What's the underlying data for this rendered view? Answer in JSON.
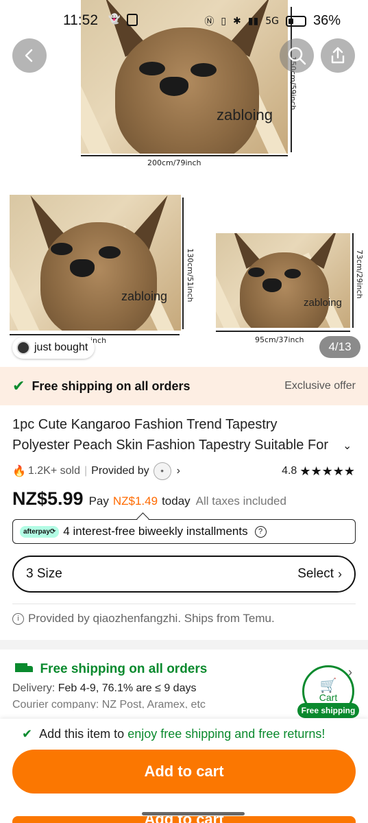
{
  "status_bar": {
    "time": "11:52",
    "battery_percent": "36%",
    "network": "5G"
  },
  "gallery": {
    "counter": "4/13",
    "just_bought": "just bought",
    "photos": [
      {
        "caption": "zabloing",
        "width_label": "200cm/79inch",
        "height_label": "150cm/59inch"
      },
      {
        "caption": "zabloing",
        "width_label": "inch",
        "height_label": "130cm/51inch"
      },
      {
        "caption": "zabloing",
        "width_label": "95cm/37inch",
        "height_label": "73cm/29inch"
      }
    ]
  },
  "shipping_banner": {
    "title": "Free shipping on all orders",
    "tag": "Exclusive offer"
  },
  "product": {
    "title": "1pc Cute Kangaroo Fashion Trend Tapestry Polyester Peach Skin Fashion Tapestry Suitable For Theme",
    "sold": "1.2K+ sold",
    "provided_by_label": "Provided by",
    "rating": "4.8",
    "stars": "★★★★★",
    "price": "NZ$5.99",
    "pay_label": "Pay",
    "pay_amount": "NZ$1.49",
    "pay_today": "today",
    "taxes": "All taxes included"
  },
  "afterpay": {
    "logo": "afterpay⟳",
    "text": "4 interest-free biweekly installments"
  },
  "size": {
    "label": "3 Size",
    "action": "Select"
  },
  "provided": "Provided by qiaozhenfangzhi. Ships from Temu.",
  "delivery": {
    "title": "Free shipping on all orders",
    "delivery_label": "Delivery:",
    "delivery_value": "Feb 4-9, 76.1% are ≤ 9 days",
    "courier_label": "Courier company:",
    "courier_value": "NZ Post, Aramex, etc"
  },
  "cart_badge": {
    "label": "Cart",
    "free": "Free shipping"
  },
  "bottom": {
    "note_prefix": "Add this item to",
    "note_green": "enjoy free shipping and free returns!",
    "add_to_cart": "Add to cart",
    "ghost_label": "Add to cart"
  },
  "colors": {
    "accent_orange": "#fb7701",
    "green": "#0a8a2e",
    "banner_bg": "#fdeee3"
  }
}
